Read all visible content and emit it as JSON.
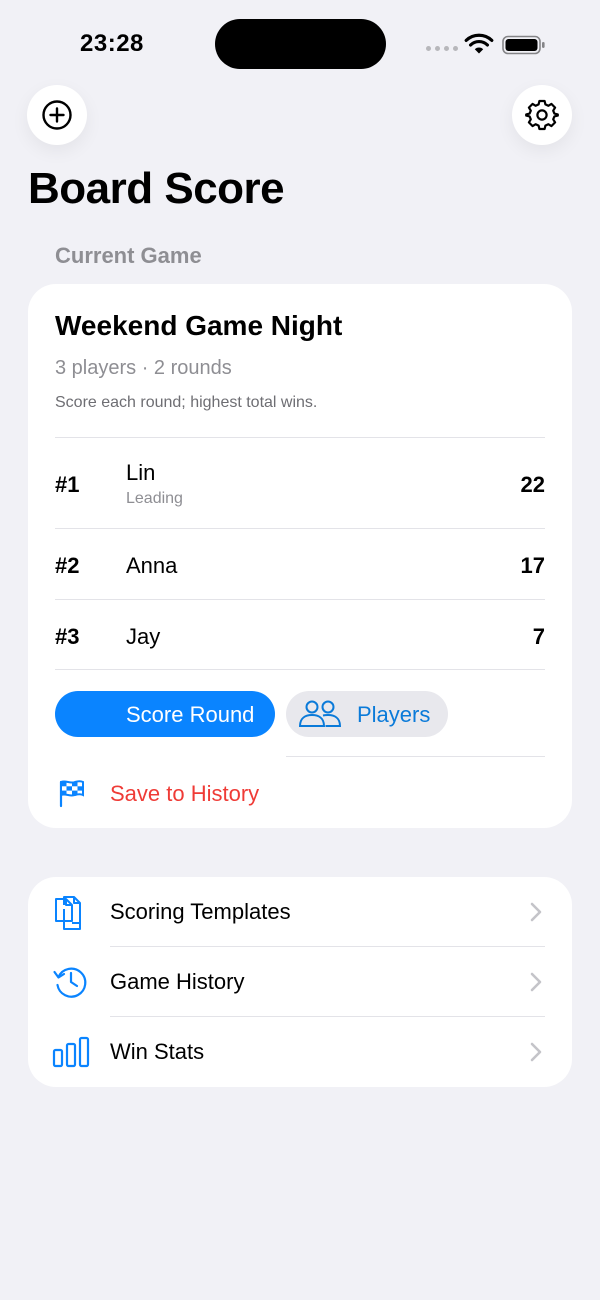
{
  "status_bar": {
    "time": "23:28"
  },
  "header": {
    "title": "Board Score"
  },
  "current_game": {
    "section_label": "Current Game",
    "title": "Weekend Game Night",
    "meta": "3 players · 2 rounds",
    "description": "Score each round; highest total wins.",
    "players": [
      {
        "rank": "#1",
        "name": "Lin",
        "status": "Leading",
        "score": "22"
      },
      {
        "rank": "#2",
        "name": "Anna",
        "status": "",
        "score": "17"
      },
      {
        "rank": "#3",
        "name": "Jay",
        "status": "",
        "score": "7"
      }
    ],
    "score_round_label": "Score Round",
    "players_label": "Players",
    "save_label": "Save to History"
  },
  "menu": {
    "items": [
      {
        "label": "Scoring Templates",
        "icon": "documents-icon"
      },
      {
        "label": "Game History",
        "icon": "clock-history-icon"
      },
      {
        "label": "Win Stats",
        "icon": "bar-chart-icon"
      }
    ]
  },
  "colors": {
    "accent": "#0a84ff",
    "destructive": "#ef3b36",
    "background": "#f1f1f6",
    "secondary_text": "#8e8e93"
  }
}
